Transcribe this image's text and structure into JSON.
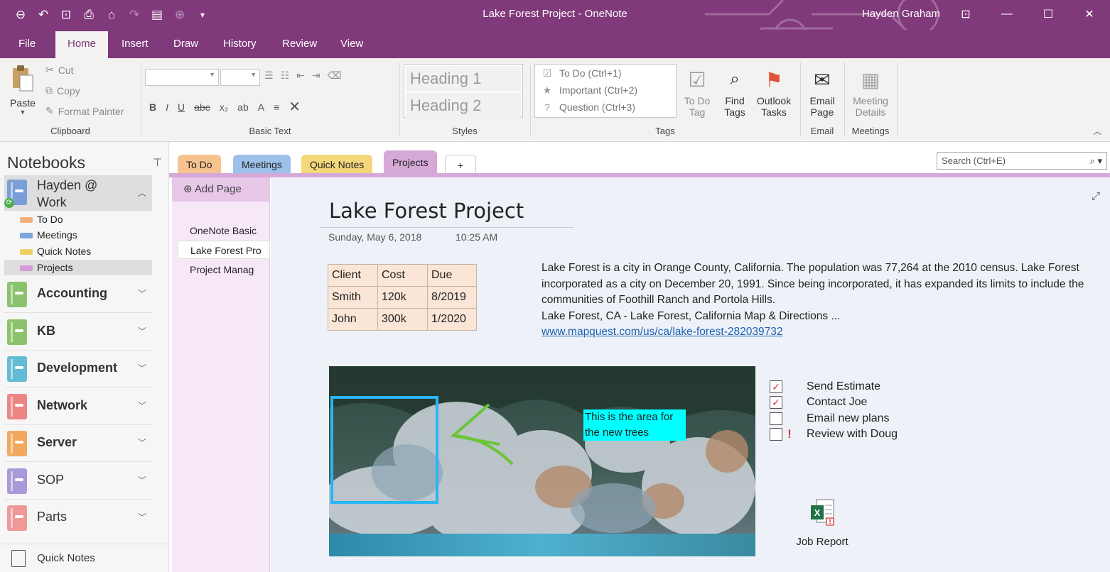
{
  "window": {
    "title": "Lake Forest Project  -  OneNote",
    "user": "Hayden Graham",
    "quick_access": [
      "back-icon",
      "undo-icon",
      "dock-icon",
      "print-preview-icon",
      "inbox-icon",
      "redo-icon",
      "print-icon",
      "forward-icon",
      "customize-icon"
    ]
  },
  "ribbon_tabs": [
    "File",
    "Home",
    "Insert",
    "Draw",
    "History",
    "Review",
    "View"
  ],
  "ribbon": {
    "clipboard": {
      "paste": "Paste",
      "cut": "Cut",
      "copy": "Copy",
      "format_painter": "Format Painter",
      "label": "Clipboard"
    },
    "basic_text": {
      "label": "Basic Text"
    },
    "styles": {
      "h1": "Heading 1",
      "h2": "Heading 2",
      "label": "Styles"
    },
    "tags": {
      "items": [
        "To Do (Ctrl+1)",
        "Important (Ctrl+2)",
        "Question (Ctrl+3)"
      ],
      "todo_tag": [
        "To Do",
        "Tag"
      ],
      "find_tags": [
        "Find",
        "Tags"
      ],
      "outlook_tasks": [
        "Outlook",
        "Tasks"
      ],
      "label": "Tags"
    },
    "email": {
      "btn": [
        "Email",
        "Page"
      ],
      "label": "Email"
    },
    "meetings": {
      "btn": [
        "Meeting",
        "Details"
      ],
      "label": "Meetings"
    }
  },
  "notebooks": {
    "header": "Notebooks",
    "current": {
      "name_line1": "Hayden @",
      "name_line2": "Work",
      "color": "#7a9fd8"
    },
    "sections": [
      {
        "label": "To Do",
        "color": "#f0b27a"
      },
      {
        "label": "Meetings",
        "color": "#7aa6dc"
      },
      {
        "label": "Quick Notes",
        "color": "#f0cf66"
      },
      {
        "label": "Projects",
        "color": "#d69ad6"
      }
    ],
    "others": [
      {
        "name": "Accounting",
        "color": "#8ac36c"
      },
      {
        "name": "KB",
        "color": "#8ac36c"
      },
      {
        "name": "Development",
        "color": "#62bcd3"
      },
      {
        "name": "Network",
        "color": "#ee8585"
      },
      {
        "name": "Server",
        "color": "#f3a85e"
      },
      {
        "name": "SOP",
        "color": "#a999d9"
      },
      {
        "name": "Parts",
        "color": "#f09797"
      }
    ],
    "footer": "Quick Notes"
  },
  "section_tabs": [
    {
      "label": "To Do",
      "color": "#f6c38f"
    },
    {
      "label": "Meetings",
      "color": "#9dc2ea"
    },
    {
      "label": "Quick Notes",
      "color": "#f4d77b"
    },
    {
      "label": "Projects",
      "color": "#d6a8d8"
    }
  ],
  "search": {
    "placeholder": "Search (Ctrl+E)"
  },
  "pages": {
    "add_label": "Add Page",
    "items": [
      "OneNote Basic",
      "Lake Forest Pro",
      "Project Manag"
    ]
  },
  "page": {
    "title": "Lake Forest Project",
    "date": "Sunday, May 6, 2018",
    "time": "10:25 AM",
    "table": [
      [
        "Client",
        "Cost",
        "Due"
      ],
      [
        "Smith",
        "120k",
        "8/2019"
      ],
      [
        "John",
        "300k",
        "1/2020"
      ]
    ],
    "description": "Lake Forest is a city in Orange County, California. The population was 77,264 at the 2010 census. Lake Forest incorporated as a city on December 20, 1991. Since being incorporated, it has expanded its limits to include the communities of Foothill Ranch and Portola Hills.",
    "link_title": "Lake Forest, CA - Lake Forest, California Map & Directions ...",
    "link_url": "www.mapquest.com/us/ca/lake-forest-282039732",
    "annotation": "This is the area for the new trees",
    "todos": [
      {
        "text": "Send Estimate",
        "checked": true,
        "important": false
      },
      {
        "text": "Contact Joe",
        "checked": true,
        "important": false
      },
      {
        "text": "Email new plans",
        "checked": false,
        "important": false
      },
      {
        "text": "Review with Doug",
        "checked": false,
        "important": true
      }
    ],
    "attachment": "Job Report"
  }
}
